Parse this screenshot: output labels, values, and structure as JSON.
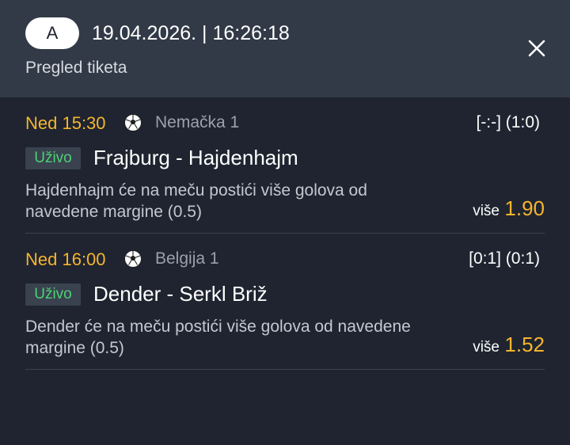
{
  "header": {
    "ticket_code": "A",
    "datetime": "19.04.2026. | 16:26:18",
    "subtitle": "Pregled tiketa",
    "close_icon": "close-icon"
  },
  "colors": {
    "accent": "#f5b52e",
    "live": "#4cd173",
    "background": "#1f2430",
    "header_bg": "#323a47"
  },
  "events": [
    {
      "time": "Ned 15:30",
      "sport_icon": "soccer-ball-icon",
      "league": "Nemačka 1",
      "score": "[-:-] (1:0)",
      "status": "Uživo",
      "teams": "Frajburg - Hajdenhajm",
      "market": "Hajdenhajm će na meču postići više golova od navedene margine (0.5)",
      "pick_label": "više",
      "odd": "1.90"
    },
    {
      "time": "Ned 16:00",
      "sport_icon": "soccer-ball-icon",
      "league": "Belgija 1",
      "score": "[0:1] (0:1)",
      "status": "Uživo",
      "teams": "Dender - Serkl Briž",
      "market": "Dender će na meču postići više golova od navedene margine (0.5)",
      "pick_label": "više",
      "odd": "1.52"
    }
  ]
}
